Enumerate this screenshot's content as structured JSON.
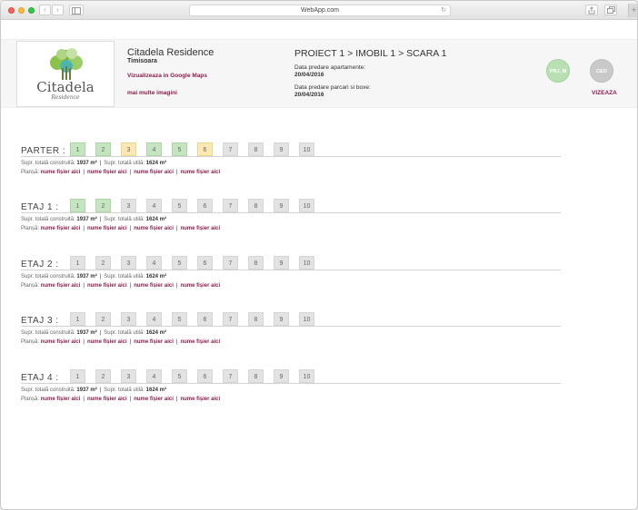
{
  "browser": {
    "url": "WebApp.com",
    "back_icon": "‹",
    "forward_icon": "›",
    "reload_icon": "↻",
    "new_tab_icon": "+"
  },
  "project": {
    "logo_word": "Citadela",
    "logo_sub": "Residence",
    "name": "Citadela Residence",
    "city": "Timisoara",
    "maps_link": "Vizualizeaza in Google Maps",
    "more_images": "mai multe imagini",
    "breadcrumb": "PROIECT 1 > IMOBIL 1 > SCARA 1",
    "apartments_label": "Data predare apartamente:",
    "apartments_date": "20/04/2016",
    "parking_label": "Data predare parcari si boxe:",
    "parking_date": "20/04/2016",
    "avatar_pm": "PRJ. M",
    "avatar_ceo": "CEO",
    "approve": "VIZEAZA"
  },
  "labels": {
    "total_built": "Supr. totală construită:",
    "total_useful": "Supr. totală utilă:",
    "plan": "Planșă:",
    "separator": "|"
  },
  "colors": {
    "accent": "#8a1e4c",
    "unit_green": "#c4e5bf",
    "unit_yellow": "#fbe8b3",
    "unit_grey": "#e3e3e3"
  },
  "floors": [
    {
      "title": "PARTER :",
      "units": [
        {
          "label": "1",
          "status": "green"
        },
        {
          "label": "2",
          "status": "green"
        },
        {
          "label": "3",
          "status": "yellow"
        },
        {
          "label": "4",
          "status": "green"
        },
        {
          "label": "5",
          "status": "green"
        },
        {
          "label": "6",
          "status": "yellow"
        },
        {
          "label": "7",
          "status": "grey"
        },
        {
          "label": "8",
          "status": "grey"
        },
        {
          "label": "9",
          "status": "grey"
        },
        {
          "label": "10",
          "status": "grey"
        }
      ],
      "built": "1937 m²",
      "useful": "1624 m²",
      "files": [
        "nume fișier aici",
        "nume fișier aici",
        "nume fișier aici",
        "nume fișier aici"
      ]
    },
    {
      "title": "ETAJ 1 :",
      "units": [
        {
          "label": "1",
          "status": "green"
        },
        {
          "label": "2",
          "status": "green"
        },
        {
          "label": "3",
          "status": "grey"
        },
        {
          "label": "4",
          "status": "grey"
        },
        {
          "label": "5",
          "status": "grey"
        },
        {
          "label": "6",
          "status": "grey"
        },
        {
          "label": "7",
          "status": "grey"
        },
        {
          "label": "8",
          "status": "grey"
        },
        {
          "label": "9",
          "status": "grey"
        },
        {
          "label": "10",
          "status": "grey"
        }
      ],
      "built": "1937 m²",
      "useful": "1624 m²",
      "files": [
        "nume fișier aici",
        "nume fișier aici",
        "nume fișier aici",
        "nume fișier aici"
      ]
    },
    {
      "title": "ETAJ 2 :",
      "units": [
        {
          "label": "1",
          "status": "grey"
        },
        {
          "label": "2",
          "status": "grey"
        },
        {
          "label": "3",
          "status": "grey"
        },
        {
          "label": "4",
          "status": "grey"
        },
        {
          "label": "5",
          "status": "grey"
        },
        {
          "label": "6",
          "status": "grey"
        },
        {
          "label": "7",
          "status": "grey"
        },
        {
          "label": "8",
          "status": "grey"
        },
        {
          "label": "9",
          "status": "grey"
        },
        {
          "label": "10",
          "status": "grey"
        }
      ],
      "built": "1937 m²",
      "useful": "1624 m²",
      "files": [
        "nume fișier aici",
        "nume fișier aici",
        "nume fișier aici",
        "nume fișier aici"
      ]
    },
    {
      "title": "ETAJ 3 :",
      "units": [
        {
          "label": "1",
          "status": "grey"
        },
        {
          "label": "2",
          "status": "grey"
        },
        {
          "label": "3",
          "status": "grey"
        },
        {
          "label": "4",
          "status": "grey"
        },
        {
          "label": "5",
          "status": "grey"
        },
        {
          "label": "6",
          "status": "grey"
        },
        {
          "label": "7",
          "status": "grey"
        },
        {
          "label": "8",
          "status": "grey"
        },
        {
          "label": "9",
          "status": "grey"
        },
        {
          "label": "10",
          "status": "grey"
        }
      ],
      "built": "1937 m²",
      "useful": "1624 m²",
      "files": [
        "nume fișier aici",
        "nume fișier aici",
        "nume fișier aici",
        "nume fișier aici"
      ]
    },
    {
      "title": "ETAJ 4 :",
      "units": [
        {
          "label": "1",
          "status": "grey"
        },
        {
          "label": "2",
          "status": "grey"
        },
        {
          "label": "3",
          "status": "grey"
        },
        {
          "label": "4",
          "status": "grey"
        },
        {
          "label": "5",
          "status": "grey"
        },
        {
          "label": "6",
          "status": "grey"
        },
        {
          "label": "7",
          "status": "grey"
        },
        {
          "label": "8",
          "status": "grey"
        },
        {
          "label": "9",
          "status": "grey"
        },
        {
          "label": "10",
          "status": "grey"
        }
      ],
      "built": "1937 m²",
      "useful": "1624 m²",
      "files": [
        "nume fișier aici",
        "nume fișier aici",
        "nume fișier aici",
        "nume fișier aici"
      ]
    }
  ]
}
